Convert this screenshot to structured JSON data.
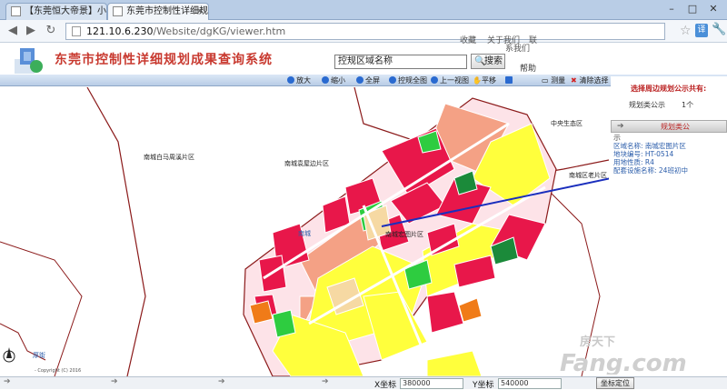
{
  "browser": {
    "tabs": [
      {
        "label": "【东莞恒大帝景】小区_二手",
        "active": false
      },
      {
        "label": "东莞市控制性详细规划成",
        "active": true
      }
    ],
    "url_host": "121.10.6.230",
    "url_path": "/Website/dgKG/viewer.htm",
    "translate_label": "译"
  },
  "header": {
    "title": "东莞市控制性详细规划成果查询系统",
    "links": [
      "收藏",
      "关于我们",
      "联",
      "系我们"
    ],
    "search_value": "控规区域名称",
    "search_button": "搜索",
    "help": "帮助"
  },
  "toolbar": {
    "items": [
      {
        "label": "放大",
        "icon": "zoom-in-icon",
        "color": "#2a6ad0"
      },
      {
        "label": "缩小",
        "icon": "zoom-out-icon",
        "color": "#2a6ad0"
      },
      {
        "label": "全屏",
        "icon": "fullscreen-icon",
        "color": "#2a6ad0"
      },
      {
        "label": "控规全图",
        "icon": "full-map-icon",
        "color": "#2a6ad0"
      },
      {
        "label": "上一视图",
        "icon": "previous-view-icon",
        "color": "#2a6ad0"
      },
      {
        "label": "平移",
        "icon": "pan-hand-icon",
        "color": "#ffffff"
      },
      {
        "label": "",
        "icon": "select-icon",
        "color": "#2a6ad0"
      },
      {
        "label": "测量",
        "icon": "measure-icon",
        "color": "#333333"
      },
      {
        "label": "清除选择",
        "icon": "clear-icon",
        "color": "#d22222"
      }
    ]
  },
  "map": {
    "labels": {
      "baima": "南城白马周溪片区",
      "biaoshao": "南城袁屋边片区",
      "zhongyang": "中央生态区",
      "fulin": "南城区老片区",
      "nancheng": "南城",
      "center": "南城宏图片区",
      "houjie": "厚街",
      "copyright": "- Copyright (C) 2016"
    },
    "colors": {
      "residential": "#e8174a",
      "commercial_salmon": "#f4a185",
      "green": "#2ecc40",
      "dark_green": "#1b8a3a",
      "yellow": "#ffff3c",
      "orange": "#f07b18",
      "beige": "#f6d9a3",
      "road": "#ffffff",
      "boundary": "#8b1a1a"
    }
  },
  "panel": {
    "title": "选择周边规划公示共有:",
    "row_label": "规划类公示",
    "row_count": "1个",
    "bar_label": "规划类公",
    "hint": "示",
    "info": [
      "区域名称: 南城宏图片区",
      "地块编号: HT-0514",
      "用地性质: R4",
      "配套设施名称: 24班初中"
    ]
  },
  "status": {
    "x_label": "X坐标",
    "x_value": "380000",
    "y_label": "Y坐标",
    "y_value": "540000",
    "locate_button": "坐标定位"
  },
  "watermark": {
    "line1": "房天下",
    "line2": "Fang.com"
  }
}
